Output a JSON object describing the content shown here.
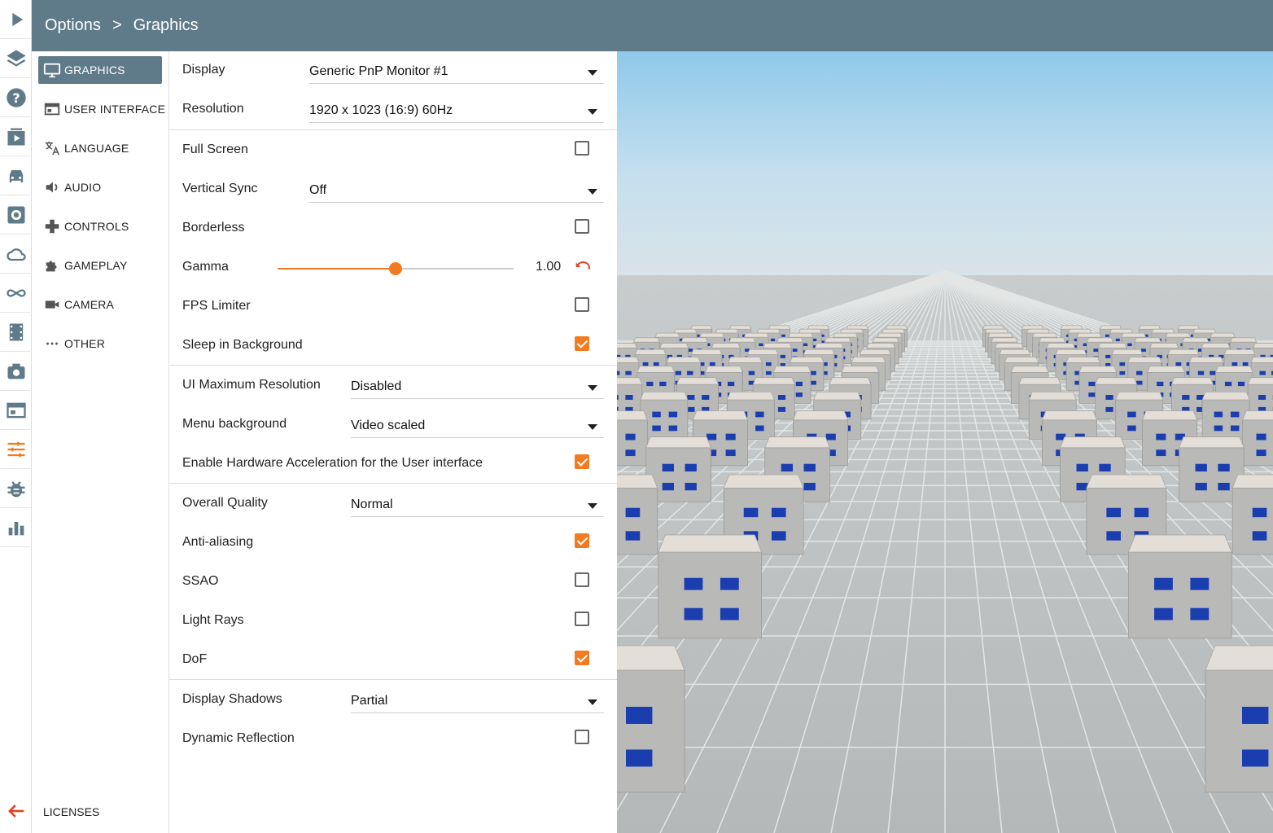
{
  "header": {
    "breadcrumb_root": "Options",
    "breadcrumb_sep": ">",
    "breadcrumb_current": "Graphics"
  },
  "rail": {
    "items": [
      {
        "icon": "play-icon"
      },
      {
        "icon": "layers-icon"
      },
      {
        "icon": "help-icon"
      },
      {
        "icon": "scenario-icon"
      },
      {
        "icon": "car-icon"
      },
      {
        "icon": "settings-gear-icon"
      },
      {
        "icon": "cloud-icon"
      },
      {
        "icon": "infinity-icon"
      },
      {
        "icon": "film-icon"
      },
      {
        "icon": "camera-icon"
      },
      {
        "icon": "window-icon"
      },
      {
        "icon": "sliders-icon"
      },
      {
        "icon": "bug-icon"
      },
      {
        "icon": "chart-icon"
      }
    ],
    "back_icon": "arrow-left-icon",
    "accent": "#f47a20"
  },
  "categories": {
    "items": [
      {
        "label": "GRAPHICS",
        "icon": "monitor-icon",
        "active": true
      },
      {
        "label": "USER INTERFACE",
        "icon": "ui-icon",
        "active": false
      },
      {
        "label": "LANGUAGE",
        "icon": "translate-icon",
        "active": false
      },
      {
        "label": "AUDIO",
        "icon": "speaker-icon",
        "active": false
      },
      {
        "label": "CONTROLS",
        "icon": "gamepad-icon",
        "active": false
      },
      {
        "label": "GAMEPLAY",
        "icon": "puzzle-icon",
        "active": false
      },
      {
        "label": "CAMERA",
        "icon": "videocam-icon",
        "active": false
      },
      {
        "label": "OTHER",
        "icon": "more-icon",
        "active": false
      }
    ],
    "licenses": "LICENSES"
  },
  "settings": {
    "display": {
      "label": "Display",
      "value": "Generic PnP Monitor #1"
    },
    "resolution": {
      "label": "Resolution",
      "value": "1920 x 1023 (16:9) 60Hz"
    },
    "full_screen": {
      "label": "Full Screen",
      "checked": false
    },
    "vertical_sync": {
      "label": "Vertical Sync",
      "value": "Off"
    },
    "borderless": {
      "label": "Borderless",
      "checked": false
    },
    "gamma": {
      "label": "Gamma",
      "value": "1.00",
      "fraction": 0.5
    },
    "fps_limiter": {
      "label": "FPS Limiter",
      "checked": false
    },
    "sleep_in_background": {
      "label": "Sleep in Background",
      "checked": true
    },
    "ui_max_resolution": {
      "label": "UI Maximum Resolution",
      "value": "Disabled"
    },
    "menu_background": {
      "label": "Menu background",
      "value": "Video scaled"
    },
    "hw_accel_ui": {
      "label": "Enable Hardware Acceleration for the User interface",
      "checked": true
    },
    "overall_quality": {
      "label": "Overall Quality",
      "value": "Normal"
    },
    "anti_aliasing": {
      "label": "Anti-aliasing",
      "checked": true
    },
    "ssao": {
      "label": "SSAO",
      "checked": false
    },
    "light_rays": {
      "label": "Light Rays",
      "checked": false
    },
    "dof": {
      "label": "DoF",
      "checked": true
    },
    "display_shadows": {
      "label": "Display Shadows",
      "value": "Partial"
    },
    "dynamic_reflection": {
      "label": "Dynamic Reflection",
      "checked": false
    }
  },
  "colors": {
    "header": "#5f7a88",
    "accent": "#f47a20"
  }
}
